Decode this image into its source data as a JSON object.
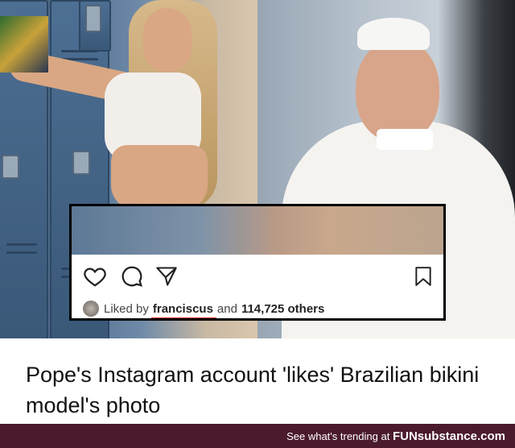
{
  "instagram": {
    "liked_by_prefix": "Liked by",
    "liked_by_user": "franciscus",
    "and_text": "and",
    "likes_count": "114,725 others"
  },
  "headline": {
    "text": "Pope's Instagram account 'likes' Brazilian bikini model's photo"
  },
  "footer": {
    "cta": "See what's trending at",
    "brand_part1": "FUN",
    "brand_part2": "substance",
    "brand_part3": ".com"
  },
  "colors": {
    "underline": "#e0281e",
    "footer_bg": "#4b1a2e"
  },
  "icons": [
    "heart-icon",
    "comment-icon",
    "share-icon",
    "bookmark-icon"
  ]
}
